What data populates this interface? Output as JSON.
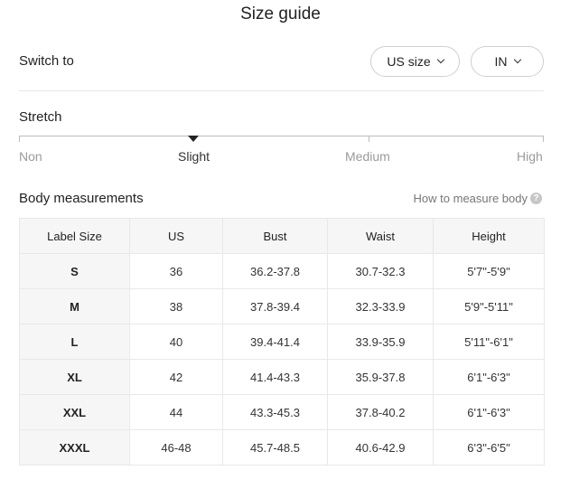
{
  "title": "Size guide",
  "switch": {
    "label": "Switch to",
    "size_system": "US size",
    "unit": "IN"
  },
  "stretch": {
    "label": "Stretch",
    "levels": [
      "Non",
      "Slight",
      "Medium",
      "High"
    ],
    "selected": "Slight"
  },
  "body_measurements": {
    "title": "Body measurements",
    "how_to_link": "How to measure body",
    "help_icon": "question-circle-icon",
    "columns": [
      "Label Size",
      "US",
      "Bust",
      "Waist",
      "Height"
    ],
    "rows": [
      [
        "S",
        "36",
        "36.2-37.8",
        "30.7-32.3",
        "5'7\"-5'9\""
      ],
      [
        "M",
        "38",
        "37.8-39.4",
        "32.3-33.9",
        "5'9\"-5'11\""
      ],
      [
        "L",
        "40",
        "39.4-41.4",
        "33.9-35.9",
        "5'11\"-6'1\""
      ],
      [
        "XL",
        "42",
        "41.4-43.3",
        "35.9-37.8",
        "6'1\"-6'3\""
      ],
      [
        "XXL",
        "44",
        "43.3-45.3",
        "37.8-40.2",
        "6'1\"-6'3\""
      ],
      [
        "XXXL",
        "46-48",
        "45.7-48.5",
        "40.6-42.9",
        "6'3\"-6'5\""
      ]
    ]
  }
}
